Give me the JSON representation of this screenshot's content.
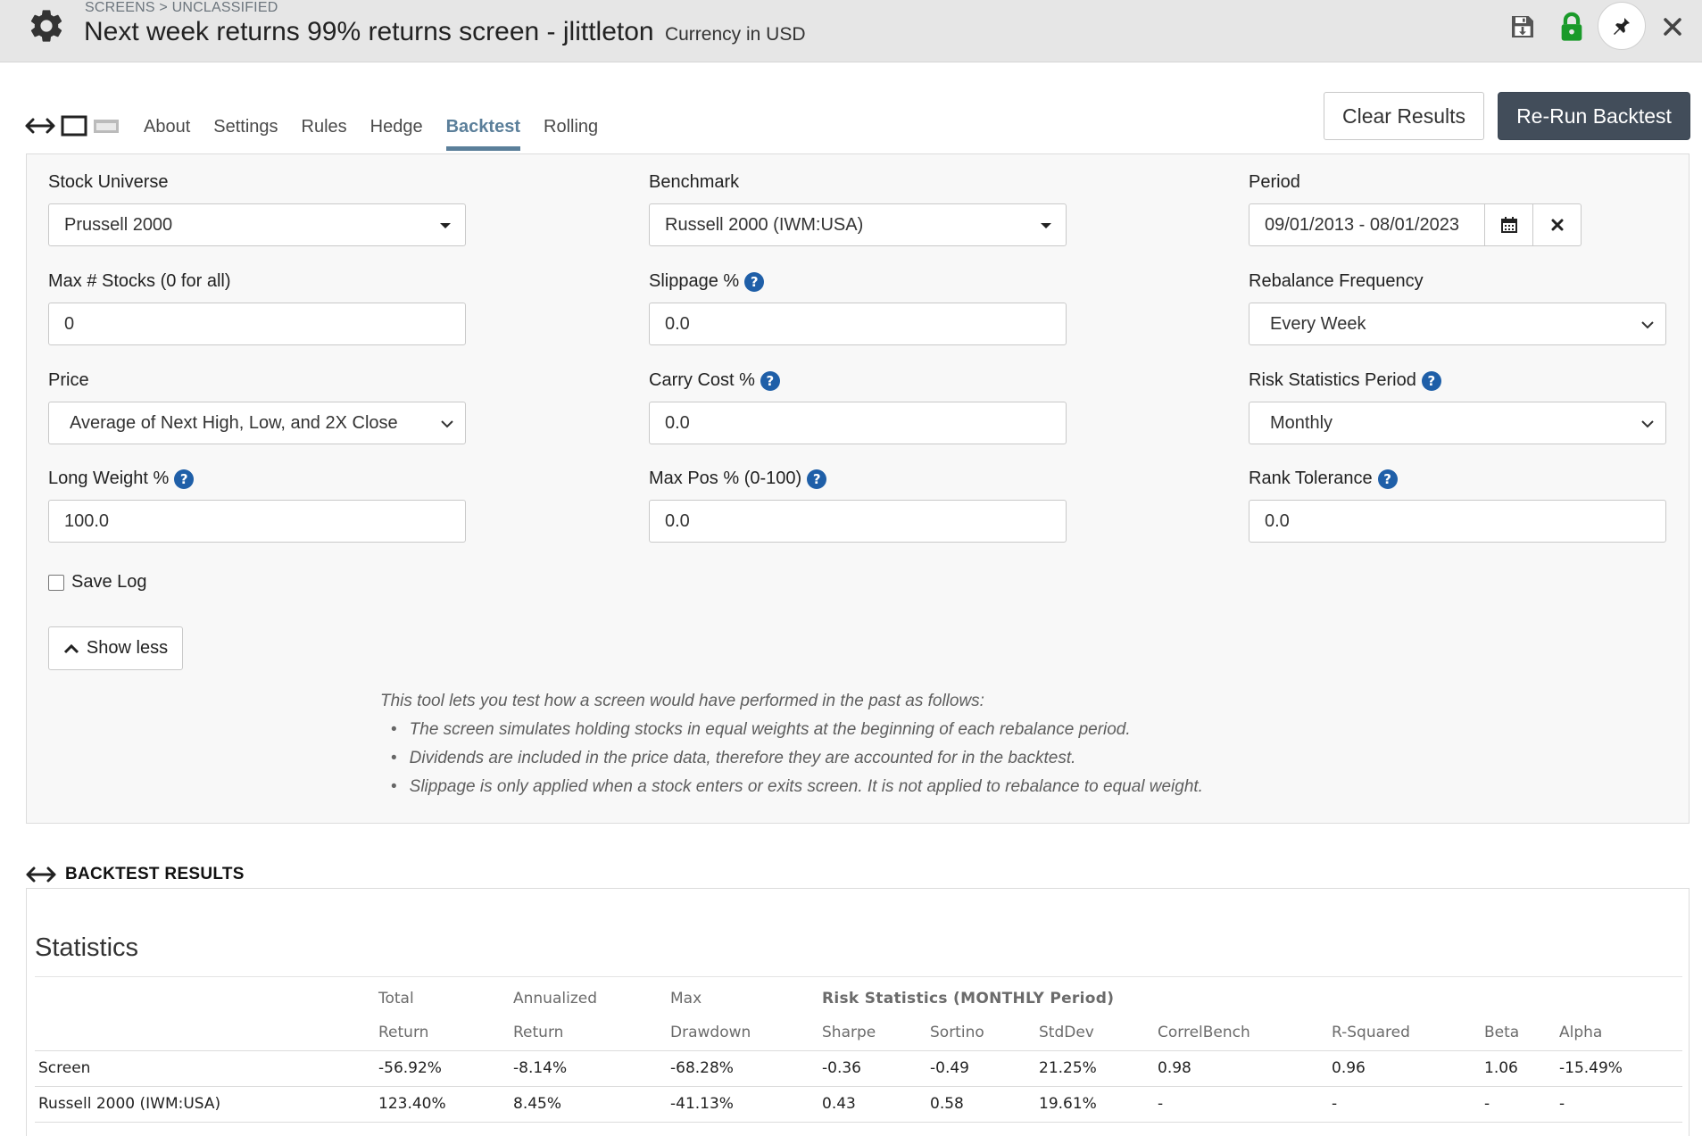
{
  "header": {
    "breadcrumb": "SCREENS > UNCLASSIFIED",
    "title": "Next week returns 99% returns screen - jlittleton",
    "currency": "Currency in USD"
  },
  "tabs": [
    "About",
    "Settings",
    "Rules",
    "Hedge",
    "Backtest",
    "Rolling"
  ],
  "active_tab": "Backtest",
  "buttons": {
    "clear": "Clear Results",
    "rerun": "Re-Run Backtest",
    "show_less": "Show less"
  },
  "form": {
    "stock_universe": {
      "label": "Stock Universe",
      "value": "Prussell 2000"
    },
    "benchmark": {
      "label": "Benchmark",
      "value": "Russell 2000 (IWM:USA)"
    },
    "period": {
      "label": "Period",
      "value": "09/01/2013 - 08/01/2023"
    },
    "max_stocks": {
      "label": "Max # Stocks (0 for all)",
      "value": "0"
    },
    "slippage": {
      "label": "Slippage %",
      "value": "0.0"
    },
    "rebalance": {
      "label": "Rebalance Frequency",
      "value": "Every Week"
    },
    "price": {
      "label": "Price",
      "value": "Average of Next High, Low, and 2X Close"
    },
    "carry_cost": {
      "label": "Carry Cost %",
      "value": "0.0"
    },
    "risk_period": {
      "label": "Risk Statistics Period",
      "value": "Monthly"
    },
    "long_weight": {
      "label": "Long Weight %",
      "value": "100.0"
    },
    "max_pos": {
      "label": "Max Pos % (0-100)",
      "value": "0.0"
    },
    "rank_tolerance": {
      "label": "Rank Tolerance",
      "value": "0.0"
    },
    "save_log": {
      "label": "Save Log",
      "checked": false
    }
  },
  "info": {
    "intro": "This tool lets you test how a screen would have performed in the past as follows:",
    "bullets": [
      "The screen simulates holding stocks in equal weights at the beginning of each rebalance period.",
      "Dividends are included in the price data, therefore they are accounted for in the backtest.",
      "Slippage is only applied when a stock enters or exits screen. It is not applied to rebalance to equal weight."
    ]
  },
  "results": {
    "heading": "BACKTEST RESULTS",
    "stats_title": "Statistics",
    "header_row1": [
      "Total",
      "Annualized",
      "Max",
      "Risk Statistics (MONTHLY Period)"
    ],
    "header_row2": [
      "Return",
      "Return",
      "Drawdown",
      "Sharpe",
      "Sortino",
      "StdDev",
      "CorrelBench",
      "R-Squared",
      "Beta",
      "Alpha"
    ],
    "rows": [
      {
        "name": "Screen",
        "values": [
          "-56.92%",
          "-8.14%",
          "-68.28%",
          "-0.36",
          "-0.49",
          "21.25%",
          "0.98",
          "0.96",
          "1.06",
          "-15.49%"
        ]
      },
      {
        "name": "Russell 2000 (IWM:USA)",
        "values": [
          "123.40%",
          "8.45%",
          "-41.13%",
          "0.43",
          "0.58",
          "19.61%",
          "-",
          "-",
          "-",
          "-"
        ]
      }
    ]
  },
  "colors": {
    "active_tab": "#5b7f9a",
    "negative": "#c00000",
    "primary_button": "#424d5a",
    "help_icon": "#1f5fa8",
    "lock_icon": "#1a9a2a"
  }
}
